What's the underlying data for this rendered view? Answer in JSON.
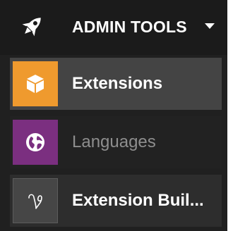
{
  "menu": {
    "title": "ADMIN TOOLS",
    "icon": "rocket-icon",
    "expand_icon": "caret-down-icon",
    "items": [
      {
        "label": "Extensions",
        "icon": "box-icon",
        "tile_color": "#ef9a2e",
        "state": "active"
      },
      {
        "label": "Languages",
        "icon": "globe-icon",
        "tile_color": "#7b2f80",
        "state": "dimmed"
      },
      {
        "label": "Extension Buil...",
        "icon": "vine-icon",
        "tile_color": "#464646",
        "state": "normal"
      }
    ]
  },
  "colors": {
    "panel_background": "#202020",
    "active_background": "#444444",
    "text_primary": "#ffffff",
    "text_dimmed": "#8e8e8e"
  }
}
